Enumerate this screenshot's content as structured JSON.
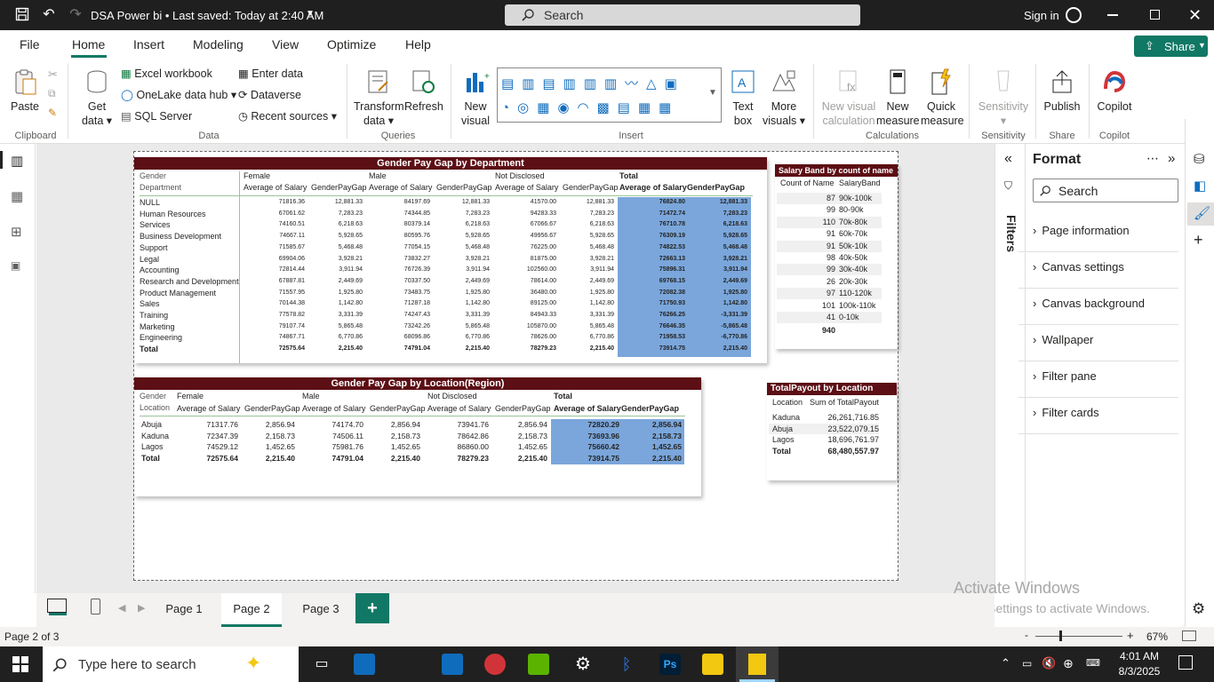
{
  "titlebar": {
    "title": "DSA Power bi • Last saved: Today at 2:40 AM",
    "search_placeholder": "Search",
    "signin": "Sign in"
  },
  "menu": {
    "file": "File",
    "home": "Home",
    "insert": "Insert",
    "modeling": "Modeling",
    "view": "View",
    "optimize": "Optimize",
    "help": "Help",
    "share": "Share"
  },
  "ribbon": {
    "paste": "Paste",
    "clipboard": "Clipboard",
    "get_data": "Get",
    "get_data2": "data",
    "excel": "Excel workbook",
    "onelake": "OneLake data hub",
    "sql": "SQL Server",
    "enter_data": "Enter data",
    "dataverse": "Dataverse",
    "recent": "Recent sources",
    "data_group": "Data",
    "transform": "Transform",
    "transform2": "data",
    "refresh": "Refresh",
    "queries": "Queries",
    "new_visual": "New",
    "new_visual2": "visual",
    "text_box": "Text",
    "text_box2": "box",
    "more_visuals": "More",
    "more_visuals2": "visuals",
    "insert_group": "Insert",
    "new_calc": "New visual",
    "new_calc2": "calculation",
    "new_measure": "New",
    "new_measure2": "measure",
    "quick_measure": "Quick",
    "quick_measure2": "measure",
    "calculations": "Calculations",
    "sensitivity": "Sensitivity",
    "sensitivity_group": "Sensitivity",
    "publish": "Publish",
    "share_group": "Share",
    "copilot": "Copilot",
    "copilot_group": "Copilot"
  },
  "visual_dept": {
    "title": "Gender Pay Gap by Department",
    "h_gender": "Gender",
    "h_dept": "Department",
    "groups": [
      "Female",
      "Male",
      "Not Disclosed",
      "Total"
    ],
    "h_avg": "Average of Salary",
    "h_gap": "GenderPayGap",
    "rows": [
      [
        "NULL",
        "71816.36",
        "12,881.33",
        "84197.69",
        "12,881.33",
        "41570.00",
        "12,881.33",
        "76824.80",
        "12,881.33"
      ],
      [
        "Human Resources",
        "67061.62",
        "7,283.23",
        "74344.85",
        "7,283.23",
        "94283.33",
        "7,283.23",
        "71472.74",
        "7,283.23"
      ],
      [
        "Services",
        "74160.51",
        "6,218.63",
        "80379.14",
        "6,218.63",
        "67066.67",
        "6,218.63",
        "76710.78",
        "6,218.63"
      ],
      [
        "Business Development",
        "74667.11",
        "5,928.65",
        "80595.76",
        "5,928.65",
        "49956.67",
        "5,928.65",
        "76309.19",
        "5,928.65"
      ],
      [
        "Support",
        "71585.67",
        "5,468.48",
        "77054.15",
        "5,468.48",
        "76225.00",
        "5,468.48",
        "74822.53",
        "5,468.48"
      ],
      [
        "Legal",
        "69904.06",
        "3,928.21",
        "73832.27",
        "3,928.21",
        "81875.00",
        "3,928.21",
        "72663.13",
        "3,928.21"
      ],
      [
        "Accounting",
        "72814.44",
        "3,911.94",
        "76726.39",
        "3,911.94",
        "102560.00",
        "3,911.94",
        "75896.31",
        "3,911.94"
      ],
      [
        "Research and Development",
        "67887.81",
        "2,449.69",
        "70337.50",
        "2,449.69",
        "78614.00",
        "2,449.69",
        "69768.15",
        "2,449.69"
      ],
      [
        "Product Management",
        "71557.95",
        "1,925.80",
        "73483.75",
        "1,925.80",
        "36480.00",
        "1,925.80",
        "72082.38",
        "1,925.80"
      ],
      [
        "Sales",
        "70144.38",
        "1,142.80",
        "71287.18",
        "1,142.80",
        "89125.00",
        "1,142.80",
        "71750.93",
        "1,142.80"
      ],
      [
        "Training",
        "77578.82",
        "3,331.39",
        "74247.43",
        "3,331.39",
        "84943.33",
        "3,331.39",
        "76266.25",
        "-3,331.39"
      ],
      [
        "Marketing",
        "79107.74",
        "5,865.48",
        "73242.26",
        "5,865.48",
        "105870.00",
        "5,865.48",
        "76646.35",
        "-5,865.48"
      ],
      [
        "Engineering",
        "74867.71",
        "6,770.86",
        "68096.86",
        "6,770.86",
        "78626.00",
        "6,770.86",
        "71958.53",
        "-6,770.86"
      ]
    ],
    "total": [
      "Total",
      "72575.64",
      "2,215.40",
      "74791.04",
      "2,215.40",
      "78279.23",
      "2,215.40",
      "73914.75",
      "2,215.40"
    ]
  },
  "visual_loc": {
    "title": "Gender Pay Gap by Location(Region)",
    "h_gender": "Gender",
    "h_loc": "Location",
    "rows": [
      [
        "Abuja",
        "71317.76",
        "2,856.94",
        "74174.70",
        "2,856.94",
        "73941.76",
        "2,856.94",
        "72820.29",
        "2,856.94"
      ],
      [
        "Kaduna",
        "72347.39",
        "2,158.73",
        "74506.11",
        "2,158.73",
        "78642.86",
        "2,158.73",
        "73693.96",
        "2,158.73"
      ],
      [
        "Lagos",
        "74529.12",
        "1,452.65",
        "75981.76",
        "1,452.65",
        "86860.00",
        "1,452.65",
        "75660.42",
        "1,452.65"
      ]
    ],
    "total": [
      "Total",
      "72575.64",
      "2,215.40",
      "74791.04",
      "2,215.40",
      "78279.23",
      "2,215.40",
      "73914.75",
      "2,215.40"
    ]
  },
  "visual_band": {
    "title": "Salary Band by count of name",
    "h_count": "Count of Name",
    "h_band": "SalaryBand",
    "rows": [
      [
        "87",
        "90k-100k"
      ],
      [
        "99",
        "80-90k"
      ],
      [
        "110",
        "70k-80k"
      ],
      [
        "91",
        "60k-70k"
      ],
      [
        "91",
        "50k-10k"
      ],
      [
        "98",
        "40k-50k"
      ],
      [
        "99",
        "30k-40k"
      ],
      [
        "26",
        "20k-30k"
      ],
      [
        "97",
        "110-120k"
      ],
      [
        "101",
        "100k-110k"
      ],
      [
        "41",
        "0-10k"
      ]
    ],
    "total": "940"
  },
  "visual_payout": {
    "title": "TotalPayout by Location",
    "h_loc": "Location",
    "h_sum": "Sum of TotalPayout",
    "rows": [
      [
        "Kaduna",
        "26,261,716.85"
      ],
      [
        "Abuja",
        "23,522,079.15"
      ],
      [
        "Lagos",
        "18,696,761.97"
      ]
    ],
    "total": [
      "Total",
      "68,480,557.97"
    ]
  },
  "filters": {
    "label": "Filters"
  },
  "format_pane": {
    "title": "Format",
    "search_placeholder": "Search",
    "items": [
      "Page information",
      "Canvas settings",
      "Canvas background",
      "Wallpaper",
      "Filter pane",
      "Filter cards"
    ]
  },
  "watermark": {
    "line1": "Activate Windows",
    "line2": "Go to Settings to activate Windows."
  },
  "tabs": [
    "Page 1",
    "Page 2",
    "Page 3"
  ],
  "status": {
    "page": "Page 2 of 3",
    "zoom": "67%"
  },
  "taskbar": {
    "search_placeholder": "Type here to search",
    "time": "4:01 AM",
    "date": "8/3/2025"
  },
  "colors": {
    "accent": "#117865",
    "header": "#5c0f15",
    "highlight": "#7aa6db"
  }
}
